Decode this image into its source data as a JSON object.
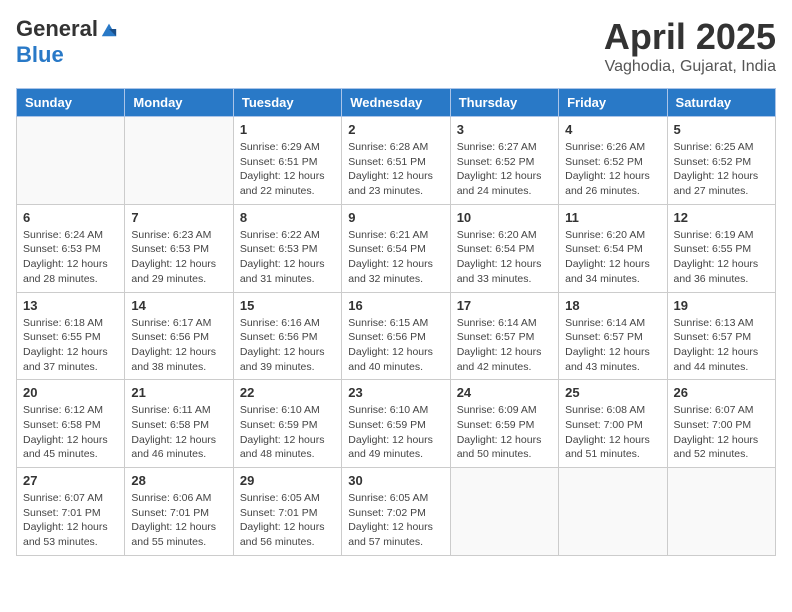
{
  "header": {
    "logo_line1": "General",
    "logo_line2": "Blue",
    "title": "April 2025",
    "location": "Vaghodia, Gujarat, India"
  },
  "days_of_week": [
    "Sunday",
    "Monday",
    "Tuesday",
    "Wednesday",
    "Thursday",
    "Friday",
    "Saturday"
  ],
  "weeks": [
    [
      {
        "day": "",
        "sunrise": "",
        "sunset": "",
        "daylight": ""
      },
      {
        "day": "",
        "sunrise": "",
        "sunset": "",
        "daylight": ""
      },
      {
        "day": "1",
        "sunrise": "Sunrise: 6:29 AM",
        "sunset": "Sunset: 6:51 PM",
        "daylight": "Daylight: 12 hours and 22 minutes."
      },
      {
        "day": "2",
        "sunrise": "Sunrise: 6:28 AM",
        "sunset": "Sunset: 6:51 PM",
        "daylight": "Daylight: 12 hours and 23 minutes."
      },
      {
        "day": "3",
        "sunrise": "Sunrise: 6:27 AM",
        "sunset": "Sunset: 6:52 PM",
        "daylight": "Daylight: 12 hours and 24 minutes."
      },
      {
        "day": "4",
        "sunrise": "Sunrise: 6:26 AM",
        "sunset": "Sunset: 6:52 PM",
        "daylight": "Daylight: 12 hours and 26 minutes."
      },
      {
        "day": "5",
        "sunrise": "Sunrise: 6:25 AM",
        "sunset": "Sunset: 6:52 PM",
        "daylight": "Daylight: 12 hours and 27 minutes."
      }
    ],
    [
      {
        "day": "6",
        "sunrise": "Sunrise: 6:24 AM",
        "sunset": "Sunset: 6:53 PM",
        "daylight": "Daylight: 12 hours and 28 minutes."
      },
      {
        "day": "7",
        "sunrise": "Sunrise: 6:23 AM",
        "sunset": "Sunset: 6:53 PM",
        "daylight": "Daylight: 12 hours and 29 minutes."
      },
      {
        "day": "8",
        "sunrise": "Sunrise: 6:22 AM",
        "sunset": "Sunset: 6:53 PM",
        "daylight": "Daylight: 12 hours and 31 minutes."
      },
      {
        "day": "9",
        "sunrise": "Sunrise: 6:21 AM",
        "sunset": "Sunset: 6:54 PM",
        "daylight": "Daylight: 12 hours and 32 minutes."
      },
      {
        "day": "10",
        "sunrise": "Sunrise: 6:20 AM",
        "sunset": "Sunset: 6:54 PM",
        "daylight": "Daylight: 12 hours and 33 minutes."
      },
      {
        "day": "11",
        "sunrise": "Sunrise: 6:20 AM",
        "sunset": "Sunset: 6:54 PM",
        "daylight": "Daylight: 12 hours and 34 minutes."
      },
      {
        "day": "12",
        "sunrise": "Sunrise: 6:19 AM",
        "sunset": "Sunset: 6:55 PM",
        "daylight": "Daylight: 12 hours and 36 minutes."
      }
    ],
    [
      {
        "day": "13",
        "sunrise": "Sunrise: 6:18 AM",
        "sunset": "Sunset: 6:55 PM",
        "daylight": "Daylight: 12 hours and 37 minutes."
      },
      {
        "day": "14",
        "sunrise": "Sunrise: 6:17 AM",
        "sunset": "Sunset: 6:56 PM",
        "daylight": "Daylight: 12 hours and 38 minutes."
      },
      {
        "day": "15",
        "sunrise": "Sunrise: 6:16 AM",
        "sunset": "Sunset: 6:56 PM",
        "daylight": "Daylight: 12 hours and 39 minutes."
      },
      {
        "day": "16",
        "sunrise": "Sunrise: 6:15 AM",
        "sunset": "Sunset: 6:56 PM",
        "daylight": "Daylight: 12 hours and 40 minutes."
      },
      {
        "day": "17",
        "sunrise": "Sunrise: 6:14 AM",
        "sunset": "Sunset: 6:57 PM",
        "daylight": "Daylight: 12 hours and 42 minutes."
      },
      {
        "day": "18",
        "sunrise": "Sunrise: 6:14 AM",
        "sunset": "Sunset: 6:57 PM",
        "daylight": "Daylight: 12 hours and 43 minutes."
      },
      {
        "day": "19",
        "sunrise": "Sunrise: 6:13 AM",
        "sunset": "Sunset: 6:57 PM",
        "daylight": "Daylight: 12 hours and 44 minutes."
      }
    ],
    [
      {
        "day": "20",
        "sunrise": "Sunrise: 6:12 AM",
        "sunset": "Sunset: 6:58 PM",
        "daylight": "Daylight: 12 hours and 45 minutes."
      },
      {
        "day": "21",
        "sunrise": "Sunrise: 6:11 AM",
        "sunset": "Sunset: 6:58 PM",
        "daylight": "Daylight: 12 hours and 46 minutes."
      },
      {
        "day": "22",
        "sunrise": "Sunrise: 6:10 AM",
        "sunset": "Sunset: 6:59 PM",
        "daylight": "Daylight: 12 hours and 48 minutes."
      },
      {
        "day": "23",
        "sunrise": "Sunrise: 6:10 AM",
        "sunset": "Sunset: 6:59 PM",
        "daylight": "Daylight: 12 hours and 49 minutes."
      },
      {
        "day": "24",
        "sunrise": "Sunrise: 6:09 AM",
        "sunset": "Sunset: 6:59 PM",
        "daylight": "Daylight: 12 hours and 50 minutes."
      },
      {
        "day": "25",
        "sunrise": "Sunrise: 6:08 AM",
        "sunset": "Sunset: 7:00 PM",
        "daylight": "Daylight: 12 hours and 51 minutes."
      },
      {
        "day": "26",
        "sunrise": "Sunrise: 6:07 AM",
        "sunset": "Sunset: 7:00 PM",
        "daylight": "Daylight: 12 hours and 52 minutes."
      }
    ],
    [
      {
        "day": "27",
        "sunrise": "Sunrise: 6:07 AM",
        "sunset": "Sunset: 7:01 PM",
        "daylight": "Daylight: 12 hours and 53 minutes."
      },
      {
        "day": "28",
        "sunrise": "Sunrise: 6:06 AM",
        "sunset": "Sunset: 7:01 PM",
        "daylight": "Daylight: 12 hours and 55 minutes."
      },
      {
        "day": "29",
        "sunrise": "Sunrise: 6:05 AM",
        "sunset": "Sunset: 7:01 PM",
        "daylight": "Daylight: 12 hours and 56 minutes."
      },
      {
        "day": "30",
        "sunrise": "Sunrise: 6:05 AM",
        "sunset": "Sunset: 7:02 PM",
        "daylight": "Daylight: 12 hours and 57 minutes."
      },
      {
        "day": "",
        "sunrise": "",
        "sunset": "",
        "daylight": ""
      },
      {
        "day": "",
        "sunrise": "",
        "sunset": "",
        "daylight": ""
      },
      {
        "day": "",
        "sunrise": "",
        "sunset": "",
        "daylight": ""
      }
    ]
  ]
}
